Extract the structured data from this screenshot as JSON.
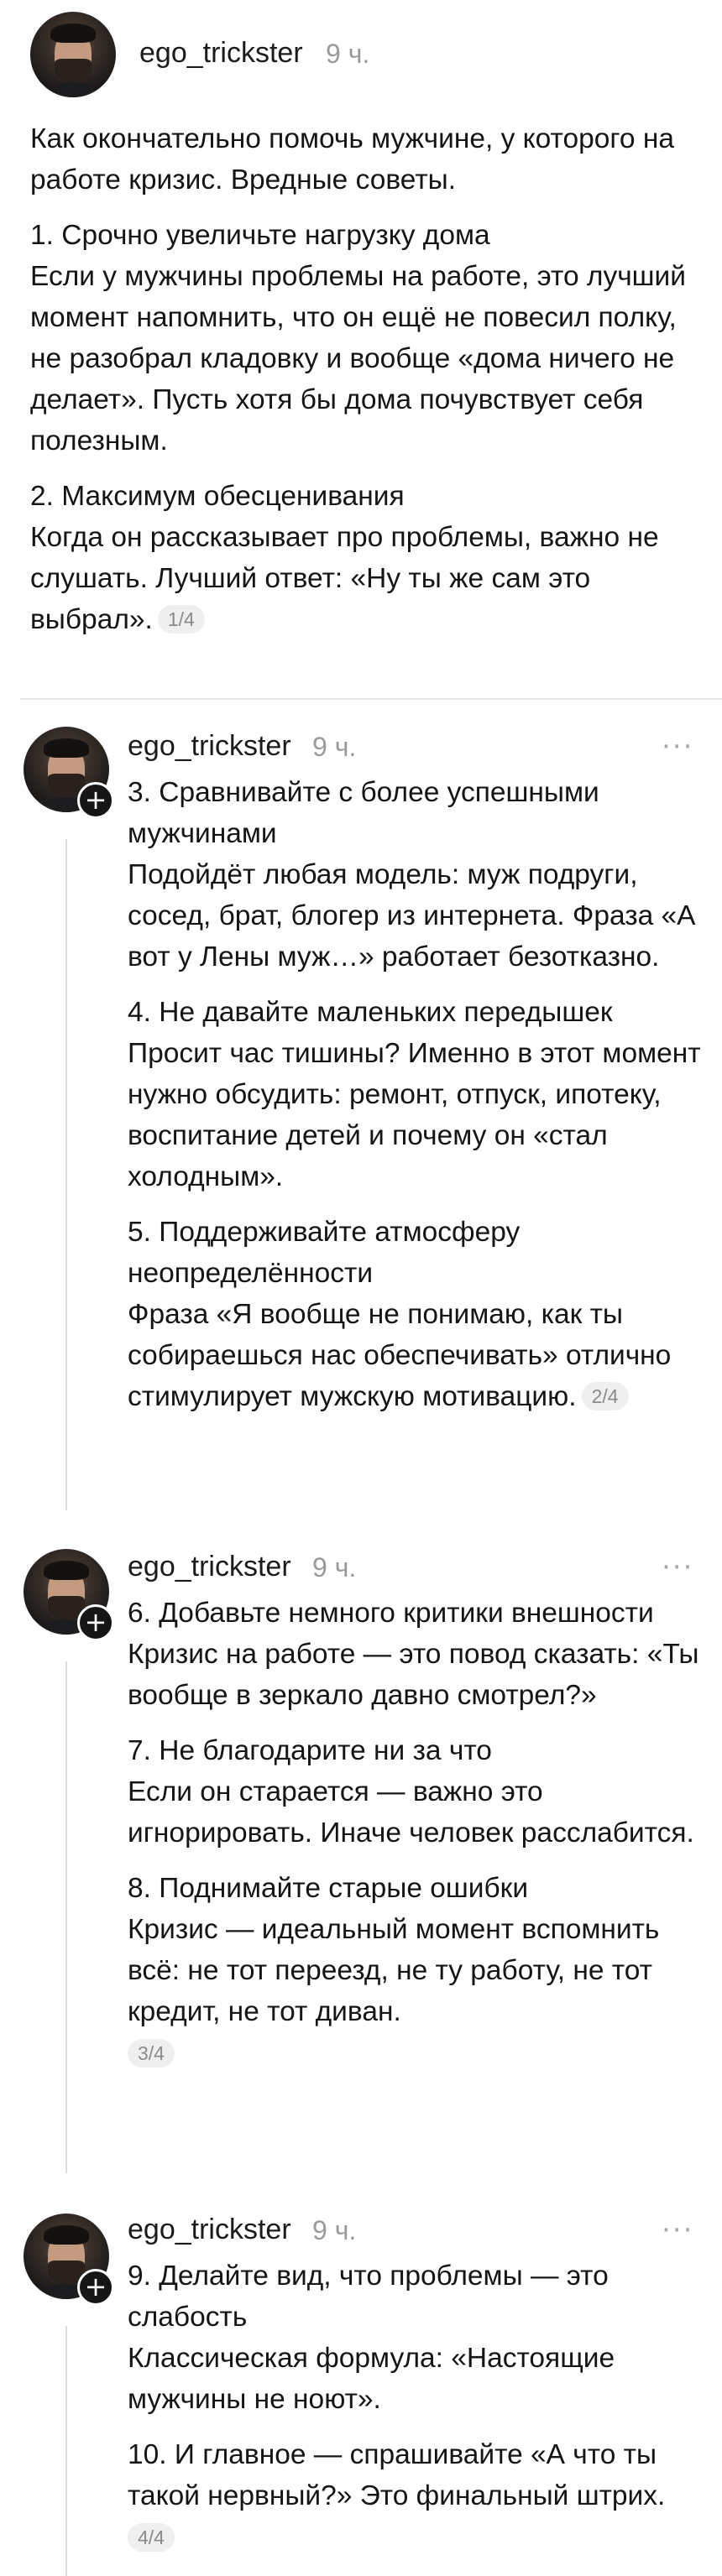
{
  "posts": [
    {
      "username": "ego_trickster",
      "time": "9 ч.",
      "paragraphs": [
        "Как окончательно помочь мужчине, у которого на работе кризис. Вредные советы.",
        "1. Срочно увеличьте нагрузку дома\nЕсли у мужчины проблемы на работе, это лучший момент напомнить, что он ещё не повесил полку, не разобрал кладовку и вообще «дома ничего не делает». Пусть хотя бы дома почувствует себя полезным.",
        "2. Максимум обесценивания\nКогда он рассказывает про проблемы, важно не слушать. Лучший ответ: «Ну ты же сам это выбрал»."
      ],
      "pager": "1/4"
    },
    {
      "username": "ego_trickster",
      "time": "9 ч.",
      "more": "···",
      "paragraphs": [
        "3. Сравнивайте с более успешными мужчинами\nПодойдёт любая модель: муж подруги, сосед, брат, блогер из интернета. Фраза «А вот у Лены муж…» работает безотказно.",
        "4. Не давайте маленьких передышек\nПросит час тишины? Именно в этот момент нужно обсудить: ремонт, отпуск, ипотеку, воспитание детей и почему он «стал холодным».",
        "5. Поддерживайте атмосферу неопределённости\nФраза «Я вообще не понимаю, как ты собираешься нас обеспечивать» отлично стимулирует мужскую мотивацию."
      ],
      "pager": "2/4"
    },
    {
      "username": "ego_trickster",
      "time": "9 ч.",
      "more": "···",
      "paragraphs": [
        "6. Добавьте немного критики внешности\nКризис на работе — это повод сказать: «Ты вообще в зеркало давно смотрел?»",
        "7. Не благодарите ни за что\nЕсли он старается — важно это игнорировать. Иначе человек расслабится.",
        "8. Поднимайте старые ошибки\nКризис — идеальный момент вспомнить всё: не тот переезд, не ту работу, не тот кредит, не тот диван."
      ],
      "pager": "3/4"
    },
    {
      "username": "ego_trickster",
      "time": "9 ч.",
      "more": "···",
      "paragraphs": [
        "9. Делайте вид, что проблемы — это слабость\nКлассическая формула: «Настоящие мужчины не ноют».",
        "10. И главное — спрашивайте «А что ты такой нервный?» Это финальный штрих."
      ],
      "pager": "4/4"
    }
  ],
  "avatar_plus_symbol": "+"
}
